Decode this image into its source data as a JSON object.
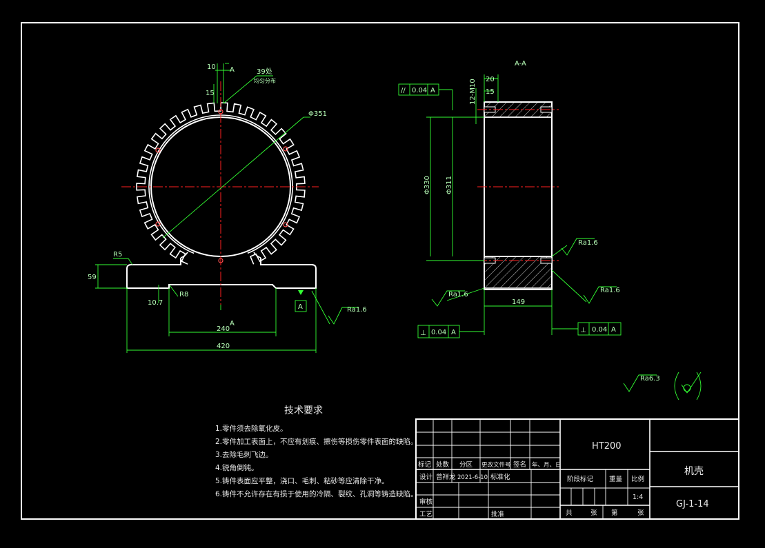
{
  "colors": {
    "background": "#000000",
    "outline": "#ffffff",
    "dimension": "#33ff33",
    "centerline": "#ff2020",
    "hatch": "#ffffff"
  },
  "front_view": {
    "dims": {
      "slot_width": "10",
      "slot_depth": "15",
      "slot_count": "39处",
      "slot_note": "均匀分布",
      "diameter": "Φ351",
      "fillet_top": "R5",
      "base_height": "59",
      "fillet_bottom": "R8",
      "base_recess": "10.7",
      "recess_width": "240",
      "base_width": "420",
      "section_mark": "A",
      "section_mark_top": "A",
      "datum": "A",
      "roughness": "Ra1.6"
    }
  },
  "section_view": {
    "title": "A-A",
    "dims": {
      "parallel_tol": "0.04",
      "parallel_datum": "A",
      "width_20": "20",
      "width_15": "15",
      "thread": "12-M10",
      "dia_outer": "Φ330",
      "dia_inner": "Φ311",
      "roughness_right": "Ra1.6",
      "roughness_left": "Ra1.6",
      "roughness_bottom": "Ra1.6",
      "length": "149",
      "perp_tol_left": "0.04",
      "perp_datum_left": "A",
      "perp_tol_right": "0.04",
      "perp_datum_right": "A"
    }
  },
  "general_roughness": "Ra6.3",
  "technical_requirements": {
    "title": "技术要求",
    "items": [
      "1.零件须去除氧化皮。",
      "2.零件加工表面上，不应有划痕、擦伤等损伤零件表面的缺陷。",
      "3.去除毛刺飞边。",
      "4.锐角倒钝。",
      "5.铸件表面应平整，浇口、毛刺、粘砂等应清除干净。",
      "6.铸件不允许存在有损于使用的冷隔、裂纹、孔洞等铸造缺陷。"
    ]
  },
  "title_block": {
    "material": "HT200",
    "part_name": "机壳",
    "drawing_no": "GJ-1-14",
    "header_labels": [
      "标记",
      "处数",
      "分区",
      "更改文件号",
      "签名",
      "年、月、日"
    ],
    "designer_label": "设计",
    "designer": "曾祥龙",
    "date": "2021-6-10",
    "standardize": "标准化",
    "stage_label": "阶段标记",
    "weight_label": "重量",
    "scale_label": "比例",
    "scale": "1:4",
    "review_label": "审核",
    "process_label": "工艺",
    "approve_label": "批准",
    "sheets_total": "共",
    "sheets_unit1": "张",
    "sheet_no": "第",
    "sheets_unit2": "张"
  }
}
